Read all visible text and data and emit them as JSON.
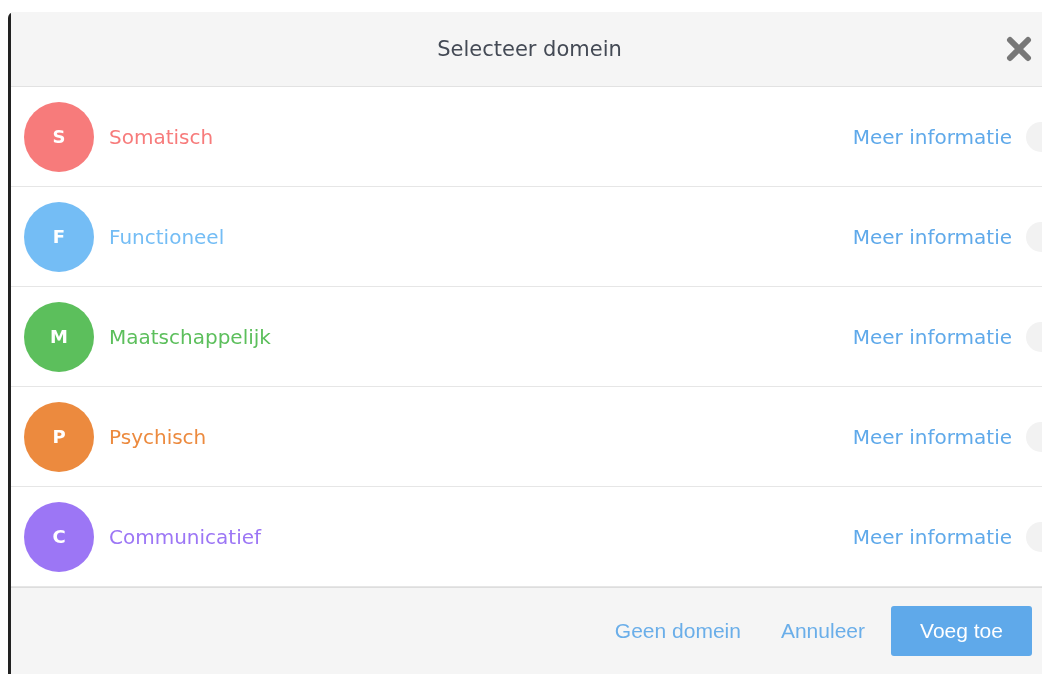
{
  "dialog": {
    "title": "Selecteer domein"
  },
  "domains": [
    {
      "initial": "S",
      "name": "Somatisch",
      "color": "#f77b7b",
      "info_link": "Meer informatie",
      "selected": false
    },
    {
      "initial": "F",
      "name": "Functioneel",
      "color": "#74bdf5",
      "info_link": "Meer informatie",
      "selected": false
    },
    {
      "initial": "M",
      "name": "Maatschappelijk",
      "color": "#5cbf5c",
      "info_link": "Meer informatie",
      "selected": false
    },
    {
      "initial": "P",
      "name": "Psychisch",
      "color": "#ec8a3e",
      "info_link": "Meer informatie",
      "selected": false
    },
    {
      "initial": "C",
      "name": "Communicatief",
      "color": "#9c76f5",
      "info_link": "Meer informatie",
      "selected": false
    }
  ],
  "footer": {
    "links": [
      "Geen domein",
      "Annuleer"
    ],
    "primary_button": "Voeg toe"
  }
}
